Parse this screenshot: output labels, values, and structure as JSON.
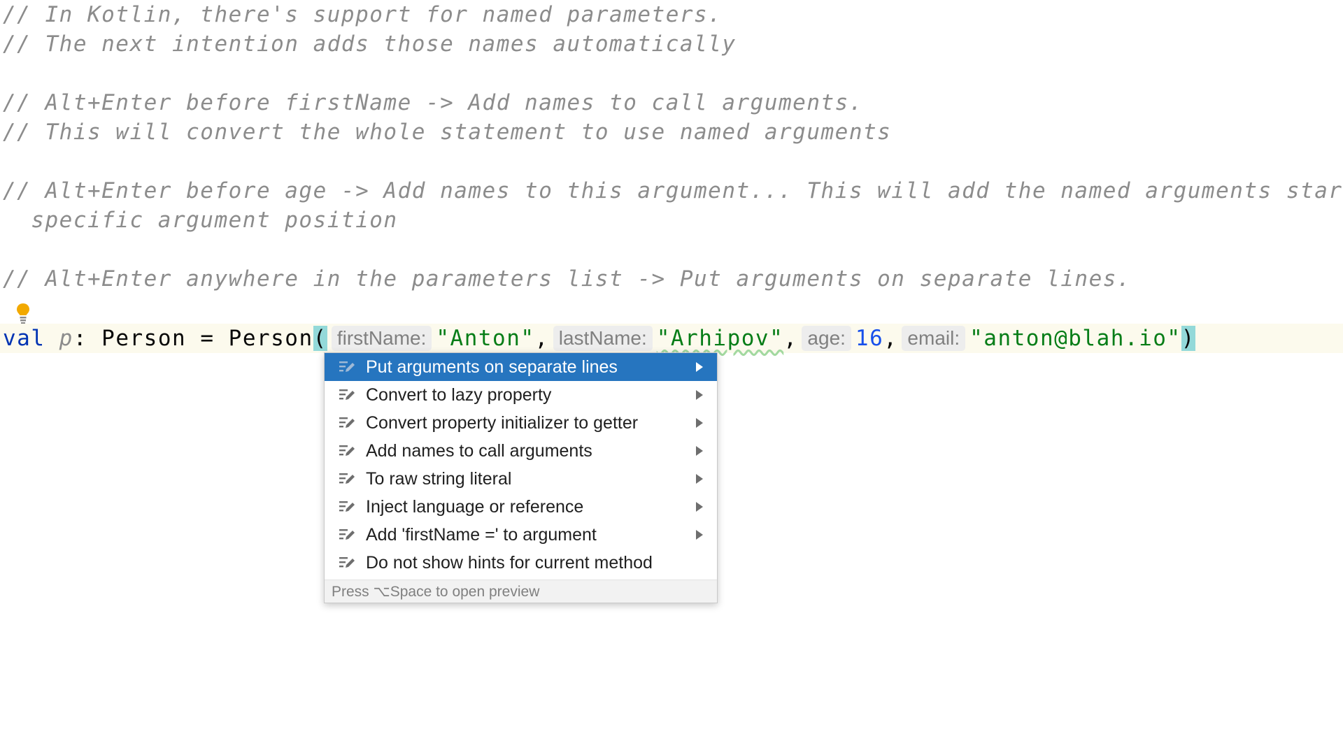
{
  "comments": [
    "// In Kotlin, there's support for named parameters.",
    "// The next intention adds those names automatically",
    "// Alt+Enter before firstName -> Add names to call arguments.",
    "// This will convert the whole statement to use named arguments",
    "// Alt+Enter before age -> Add names to this argument... This will add the named arguments start",
    "  specific argument position",
    "// Alt+Enter anywhere in the parameters list -> Put arguments on separate lines."
  ],
  "code": {
    "keyword": "val",
    "variable": "p",
    "colon": ": ",
    "type": "Person",
    "assign": " = ",
    "ctor": "Person",
    "open_paren": "(",
    "close_paren": ")",
    "comma": ",",
    "args": [
      {
        "hint": "firstName:",
        "value": "\"Anton\""
      },
      {
        "hint": "lastName:",
        "value": "\"Arhipov\""
      },
      {
        "hint": "age:",
        "value": "16"
      },
      {
        "hint": "email:",
        "value": "\"anton@blah.io\""
      }
    ]
  },
  "intention_menu": {
    "items": [
      {
        "label": "Put arguments on separate lines",
        "has_submenu": true,
        "selected": true
      },
      {
        "label": "Convert to lazy property",
        "has_submenu": true
      },
      {
        "label": "Convert property initializer to getter",
        "has_submenu": true
      },
      {
        "label": "Add names to call arguments",
        "has_submenu": true
      },
      {
        "label": "To raw string literal",
        "has_submenu": true
      },
      {
        "label": "Inject language or reference",
        "has_submenu": true
      },
      {
        "label": "Add 'firstName =' to argument",
        "has_submenu": true
      },
      {
        "label": "Do not show hints for current method",
        "has_submenu": false
      }
    ],
    "footer": "Press ⌥Space to open preview"
  },
  "colors": {
    "accent": "#2675bf",
    "comment": "#8c8c8c",
    "keyword": "#0033b3",
    "string": "#067d17",
    "number": "#1750eb",
    "bulb": "#f2a900"
  }
}
